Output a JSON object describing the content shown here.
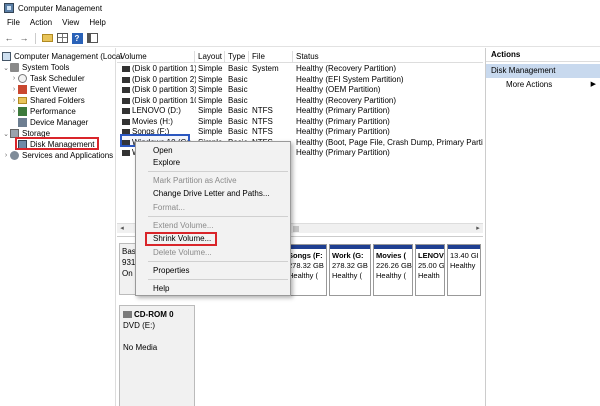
{
  "window": {
    "title": "Computer Management"
  },
  "menubar": [
    "File",
    "Action",
    "View",
    "Help"
  ],
  "toolbar": {
    "back": "←",
    "forward": "→",
    "help": "?"
  },
  "tree": {
    "root": "Computer Management (Local",
    "system_tools": "System Tools",
    "task_scheduler": "Task Scheduler",
    "event_viewer": "Event Viewer",
    "shared_folders": "Shared Folders",
    "performance": "Performance",
    "device_manager": "Device Manager",
    "storage": "Storage",
    "disk_management": "Disk Management",
    "services": "Services and Applications",
    "expanded": "⌄",
    "collapsed": "›"
  },
  "volumes": {
    "headers": [
      "Volume",
      "Layout",
      "Type",
      "File System",
      "Status"
    ],
    "rows": [
      [
        "(Disk 0 partition 1)",
        "Simple",
        "Basic",
        "",
        "Healthy (Recovery Partition)"
      ],
      [
        "(Disk 0 partition 2)",
        "Simple",
        "Basic",
        "",
        "Healthy (EFI System Partition)"
      ],
      [
        "(Disk 0 partition 3)",
        "Simple",
        "Basic",
        "",
        "Healthy (OEM Partition)"
      ],
      [
        "(Disk 0 partition 10)",
        "Simple",
        "Basic",
        "",
        "Healthy (Recovery Partition)"
      ],
      [
        "LENOVO (D:)",
        "Simple",
        "Basic",
        "NTFS",
        "Healthy (Primary Partition)"
      ],
      [
        "Movies (H:)",
        "Simple",
        "Basic",
        "NTFS",
        "Healthy (Primary Partition)"
      ],
      [
        "Songs (F:)",
        "Simple",
        "Basic",
        "NTFS",
        "Healthy (Primary Partition)"
      ],
      [
        "Windows 10 (C:)",
        "Simple",
        "Basic",
        "NTFS",
        "Healthy (Boot, Page File, Crash Dump, Primary Partition)"
      ],
      [
        "Work (G:)",
        "Simple",
        "Basic",
        "NTFS",
        "Healthy (Primary Partition)"
      ]
    ]
  },
  "scroll": {
    "left": "◂",
    "right": "▸"
  },
  "diskmap": {
    "disk0": {
      "l1": "Bas",
      "l2": "931",
      "l3": "On"
    },
    "partitions": [
      {
        "name": "Songs (F:",
        "size": "278.32 GB",
        "status": "Healthy ("
      },
      {
        "name": "Work (G:",
        "size": "278.32 GB",
        "status": "Healthy ("
      },
      {
        "name": "Movies (",
        "size": "226.26 GB",
        "status": "Healthy ("
      },
      {
        "name": "LENOV",
        "size": "25.00 GI",
        "status": "Health"
      },
      {
        "name": "",
        "size": "13.40 GI",
        "status": "Healthy"
      }
    ],
    "cdrom": {
      "title": "CD-ROM 0",
      "drive": "DVD (E:)",
      "media": "No Media"
    }
  },
  "actions": {
    "title": "Actions",
    "section": "Disk Management",
    "more": "More Actions",
    "more_arrow": "▶"
  },
  "context_menu": {
    "open": "Open",
    "explore": "Explore",
    "mark_active": "Mark Partition as Active",
    "change_letter": "Change Drive Letter and Paths...",
    "format": "Format...",
    "extend": "Extend Volume...",
    "shrink": "Shrink Volume...",
    "delete": "Delete Volume...",
    "properties": "Properties",
    "help": "Help"
  },
  "colors": {
    "highlight_red": "#d9252a",
    "selection_blue": "#2b57c0",
    "partition_cap": "#1f3f91",
    "action_section": "#c8d9ee"
  }
}
